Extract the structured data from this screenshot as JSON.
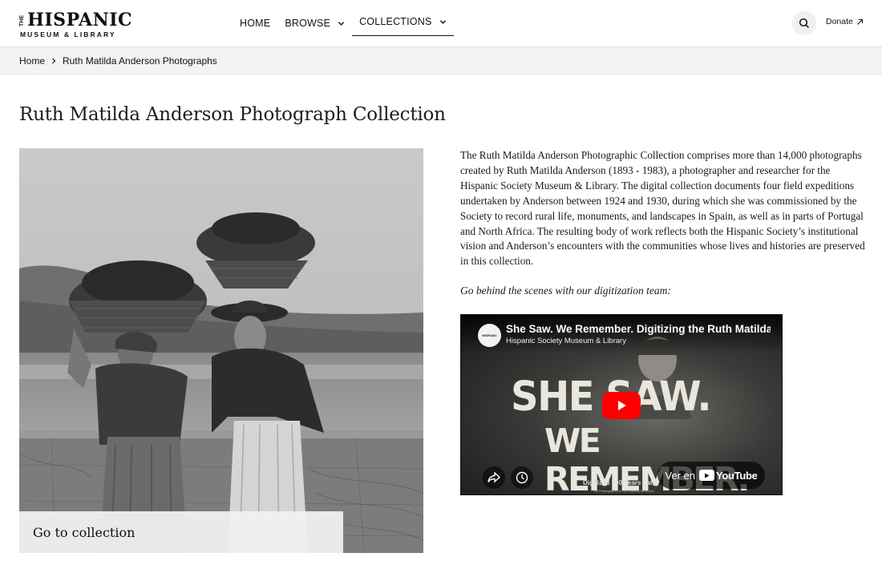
{
  "header": {
    "logo_the": "THE",
    "logo_name": "HISPANIC",
    "logo_sub": "MUSEUM & LIBRARY",
    "nav": [
      {
        "label": "HOME"
      },
      {
        "label": "BROWSE"
      },
      {
        "label": "COLLECTIONS"
      }
    ],
    "donate_label": "Donate"
  },
  "breadcrumb": {
    "home": "Home",
    "current": "Ruth Matilda Anderson Photographs"
  },
  "page": {
    "title": "Ruth Matilda Anderson Photograph Collection",
    "goto_label": "Go to collection",
    "description": "The Ruth Matilda Anderson Photographic Collection comprises more than 14,000 photographs created by Ruth Matilda Anderson (1893 - 1983), a photographer and researcher for the Hispanic Society Museum & Library. The digital collection documents four field expeditions undertaken by Anderson between 1924 and 1930, during which she was commissioned by the Society to record rural life, monuments, and landscapes in Spain, as well as in parts of Portugal and North Africa. The resulting body of work reflects both the Hispanic Society’s institutional vision and Anderson’s encounters with the communities whose lives and histories are preserved in this collection.",
    "behind_scenes": "Go behind the scenes with our digitization team:"
  },
  "video": {
    "title": "She Saw. We Remember. Digitizing the Ruth Matilda Anderson Photographs",
    "channel": "Hispanic Society Museum & Library",
    "logo_text": "HISPANIC",
    "headline_1": "SHE SAW.",
    "headline_2": "WE REMEMBER.",
    "watch_on": "Ver en",
    "youtube": "YouTube",
    "digitized": "Digitized 100 Years Later",
    "digitized_sub": "The Photographs of Ruth Matilda Anderson"
  },
  "colors": {
    "play_button": "#ff0000",
    "crumb_bg": "#f3f3f3"
  }
}
